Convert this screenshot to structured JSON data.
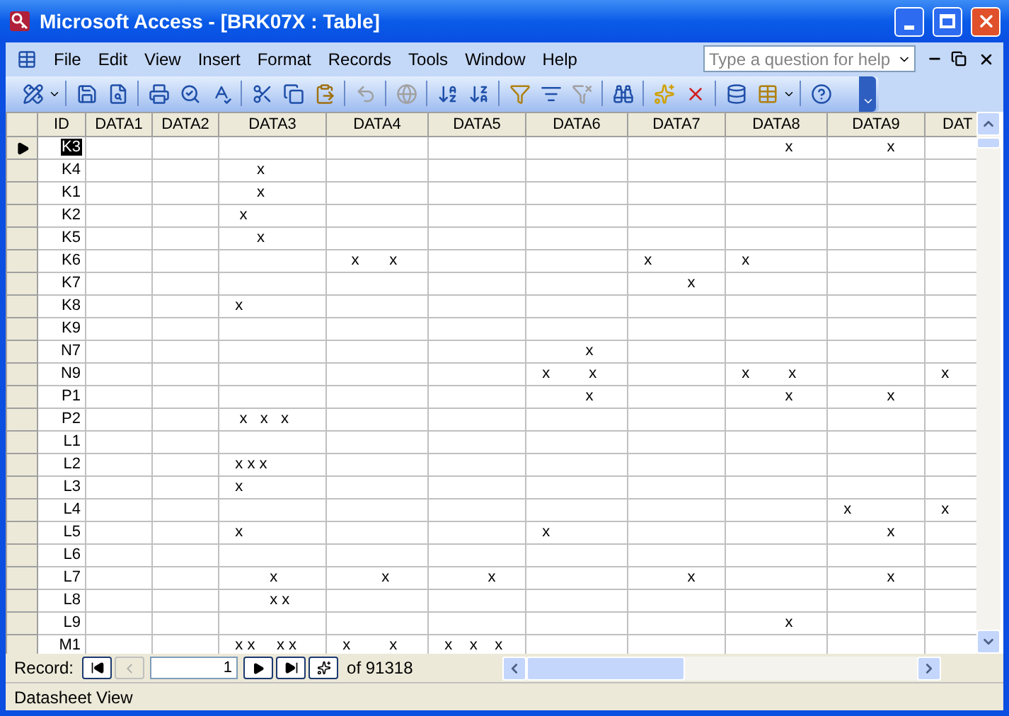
{
  "window": {
    "title": "Microsoft Access - [BRK07X : Table]"
  },
  "menu": [
    "File",
    "Edit",
    "View",
    "Insert",
    "Format",
    "Records",
    "Tools",
    "Window",
    "Help"
  ],
  "help_box": {
    "placeholder": "Type a question for help"
  },
  "table": {
    "columns": [
      "ID",
      "DATA1",
      "DATA2",
      "DATA3",
      "DATA4",
      "DATA5",
      "DATA6",
      "DATA7",
      "DATA8",
      "DATA9",
      "DAT"
    ],
    "rows": [
      {
        "selected": true,
        "cells": [
          "K3",
          "",
          "",
          "",
          "",
          "",
          "",
          "",
          "             x",
          "             x",
          ""
        ]
      },
      {
        "selected": false,
        "cells": [
          "K4",
          "",
          "",
          "        x",
          "",
          "",
          "",
          "",
          "",
          "",
          ""
        ]
      },
      {
        "selected": false,
        "cells": [
          "K1",
          "",
          "",
          "        x",
          "",
          "",
          "",
          "",
          "",
          "",
          ""
        ]
      },
      {
        "selected": false,
        "cells": [
          "K2",
          "",
          "",
          "    x",
          "",
          "",
          "",
          "",
          "",
          "",
          ""
        ]
      },
      {
        "selected": false,
        "cells": [
          "K5",
          "",
          "",
          "        x",
          "",
          "",
          "",
          "",
          "",
          "",
          ""
        ]
      },
      {
        "selected": false,
        "cells": [
          "K6",
          "",
          "",
          "",
          "     x       x",
          "",
          "",
          "   x",
          "   x",
          "",
          ""
        ]
      },
      {
        "selected": false,
        "cells": [
          "K7",
          "",
          "",
          "",
          "",
          "",
          "",
          "             x",
          "",
          "",
          ""
        ]
      },
      {
        "selected": false,
        "cells": [
          "K8",
          "",
          "",
          "   x",
          "",
          "",
          "",
          "",
          "",
          "",
          ""
        ]
      },
      {
        "selected": false,
        "cells": [
          "K9",
          "",
          "",
          "",
          "",
          "",
          "",
          "",
          "",
          "",
          ""
        ]
      },
      {
        "selected": false,
        "cells": [
          "N7",
          "",
          "",
          "",
          "",
          "",
          "             x",
          "",
          "",
          "",
          ""
        ]
      },
      {
        "selected": false,
        "cells": [
          "N9",
          "",
          "",
          "",
          "",
          "",
          "   x         x",
          "",
          "   x         x",
          "",
          "   x"
        ]
      },
      {
        "selected": false,
        "cells": [
          "P1",
          "",
          "",
          "",
          "",
          "",
          "             x",
          "",
          "             x",
          "             x",
          ""
        ]
      },
      {
        "selected": false,
        "cells": [
          "P2",
          "",
          "",
          "    x   x   x",
          "",
          "",
          "",
          "",
          "",
          "",
          ""
        ]
      },
      {
        "selected": false,
        "cells": [
          "L1",
          "",
          "",
          "",
          "",
          "",
          "",
          "",
          "",
          "",
          ""
        ]
      },
      {
        "selected": false,
        "cells": [
          "L2",
          "",
          "",
          "   x x x",
          "",
          "",
          "",
          "",
          "",
          "",
          ""
        ]
      },
      {
        "selected": false,
        "cells": [
          "L3",
          "",
          "",
          "   x",
          "",
          "",
          "",
          "",
          "",
          "",
          ""
        ]
      },
      {
        "selected": false,
        "cells": [
          "L4",
          "",
          "",
          "",
          "",
          "",
          "",
          "",
          "",
          "   x",
          "   x"
        ]
      },
      {
        "selected": false,
        "cells": [
          "L5",
          "",
          "",
          "   x",
          "",
          "",
          "   x",
          "",
          "",
          "             x",
          ""
        ]
      },
      {
        "selected": false,
        "cells": [
          "L6",
          "",
          "",
          "",
          "",
          "",
          "",
          "",
          "",
          "",
          ""
        ]
      },
      {
        "selected": false,
        "cells": [
          "L7",
          "",
          "",
          "           x",
          "            x",
          "             x",
          "",
          "             x",
          "",
          "             x",
          ""
        ]
      },
      {
        "selected": false,
        "cells": [
          "L8",
          "",
          "",
          "           x x",
          "",
          "",
          "",
          "",
          "",
          "",
          ""
        ]
      },
      {
        "selected": false,
        "cells": [
          "L9",
          "",
          "",
          "",
          "",
          "",
          "",
          "",
          "             x",
          "",
          ""
        ]
      },
      {
        "selected": false,
        "cells": [
          "M1",
          "",
          "",
          "   x x     x x",
          "   x         x",
          "   x    x    x",
          "",
          "",
          "",
          "",
          ""
        ]
      }
    ]
  },
  "navigation": {
    "label": "Record:",
    "current": "1",
    "total": "of 91318",
    "previous_disabled": true
  },
  "status_bar": {
    "text": "Datasheet View"
  }
}
